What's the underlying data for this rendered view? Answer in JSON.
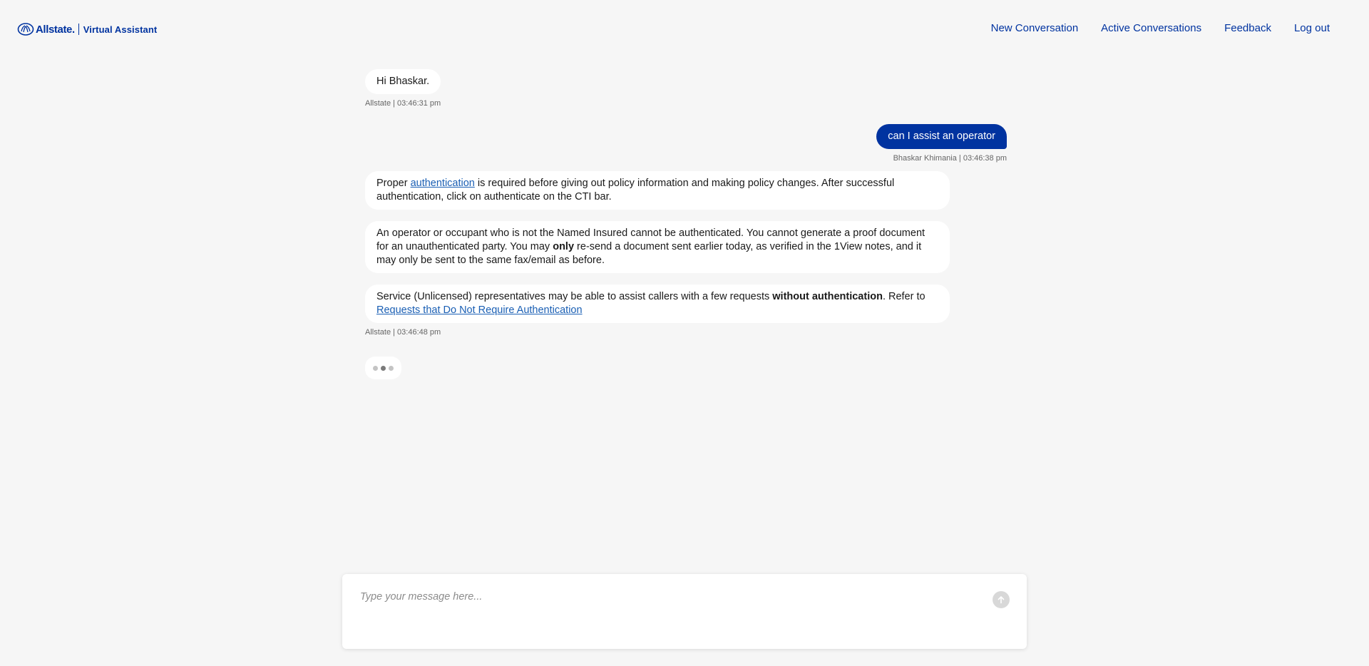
{
  "header": {
    "brand": "Allstate.",
    "product": "Virtual Assistant",
    "nav": [
      {
        "label": "New Conversation"
      },
      {
        "label": "Active Conversations"
      },
      {
        "label": "Feedback"
      },
      {
        "label": "Log out"
      }
    ]
  },
  "messages": {
    "greeting": {
      "text": "Hi Bhaskar.",
      "meta": "Allstate | 03:46:31 pm"
    },
    "user": {
      "text": "can I assist an operator",
      "meta": "Bhaskar Khimania | 03:46:38 pm"
    },
    "reply1": {
      "pre": "Proper ",
      "link": "authentication",
      "post": " is required before giving out policy information and making policy changes. After successful authentication, click on authenticate on the CTI bar."
    },
    "reply2": {
      "pre": "An operator or occupant who is not the Named Insured cannot be authenticated. You cannot generate a proof document for an unauthenticated party. You may ",
      "bold": "only",
      "post": " re-send a document sent earlier today, as verified in the 1View notes, and it may only be sent to the same fax/email as before."
    },
    "reply3": {
      "pre": "Service (Unlicensed) representatives may be able to assist callers with a few requests ",
      "bold": "without authentication",
      "mid": ". Refer to ",
      "link": "Requests that Do Not Require Authentication"
    },
    "reply_meta": "Allstate | 03:46:48 pm"
  },
  "composer": {
    "placeholder": "Type your message here...",
    "value": "",
    "send_icon": "arrow-up-icon"
  },
  "colors": {
    "brand_blue": "#0033a0",
    "background": "#f6f6f6",
    "link": "#1a5fb4"
  }
}
